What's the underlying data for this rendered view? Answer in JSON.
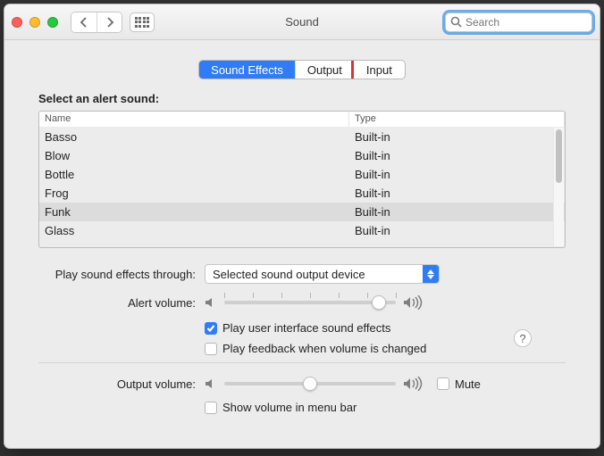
{
  "window": {
    "title": "Sound"
  },
  "search": {
    "placeholder": "Search",
    "value": ""
  },
  "tabs": {
    "sound_effects": "Sound Effects",
    "output": "Output",
    "input": "Input",
    "active": "sound_effects"
  },
  "alert_sound_section": {
    "prompt": "Select an alert sound:",
    "columns": {
      "name": "Name",
      "type": "Type"
    },
    "rows": [
      {
        "name": "Basso",
        "type": "Built-in"
      },
      {
        "name": "Blow",
        "type": "Built-in"
      },
      {
        "name": "Bottle",
        "type": "Built-in"
      },
      {
        "name": "Frog",
        "type": "Built-in"
      },
      {
        "name": "Funk",
        "type": "Built-in"
      },
      {
        "name": "Glass",
        "type": "Built-in"
      }
    ],
    "selected_index": 4
  },
  "play_through": {
    "label": "Play sound effects through:",
    "value": "Selected sound output device"
  },
  "alert_volume": {
    "label": "Alert volume:",
    "value_pct": 90,
    "ticks": 7
  },
  "checkboxes": {
    "ui_sounds": {
      "label": "Play user interface sound effects",
      "checked": true
    },
    "feedback": {
      "label": "Play feedback when volume is changed",
      "checked": false
    }
  },
  "help_glyph": "?",
  "output_volume": {
    "label": "Output volume:",
    "value_pct": 50
  },
  "mute": {
    "label": "Mute",
    "checked": false
  },
  "menubar": {
    "label": "Show volume in menu bar",
    "checked": false
  }
}
